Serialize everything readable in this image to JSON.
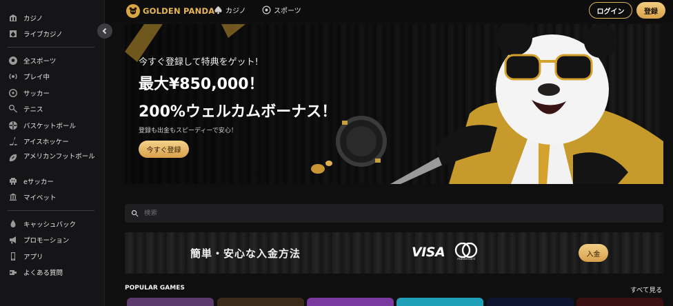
{
  "sidebar": {
    "group1": [
      {
        "label": "カジノ",
        "icon": "casino-icon"
      },
      {
        "label": "ライブカジノ",
        "icon": "live-casino-icon"
      }
    ],
    "group2": [
      {
        "label": "全スポーツ",
        "icon": "all-sports-icon"
      },
      {
        "label": "プレイ中",
        "icon": "live-play-icon"
      },
      {
        "label": "サッカー",
        "icon": "soccer-icon"
      },
      {
        "label": "テニス",
        "icon": "tennis-icon"
      },
      {
        "label": "バスケットボール",
        "icon": "basketball-icon"
      },
      {
        "label": "アイスホッケー",
        "icon": "ice-hockey-icon"
      },
      {
        "label": "アメリカンフットボール",
        "icon": "american-football-icon"
      },
      {
        "label": "eサッカー",
        "icon": "esoccer-icon"
      },
      {
        "label": "マイベット",
        "icon": "my-bets-icon"
      }
    ],
    "group3": [
      {
        "label": "キャッシュバック",
        "icon": "cashback-icon"
      },
      {
        "label": "プロモーション",
        "icon": "promotion-icon"
      },
      {
        "label": "アプリ",
        "icon": "app-icon"
      },
      {
        "label": "よくある質問",
        "icon": "faq-icon"
      }
    ]
  },
  "header": {
    "logo_text": "GOLDEN PANDA",
    "nav_casino": "カジノ",
    "nav_sports": "スポーツ",
    "login_label": "ログイン",
    "register_label": "登録"
  },
  "hero": {
    "subtitle": "今すぐ登録して特典をゲット!",
    "title1": "最大¥850,000！",
    "title2": "200%ウェルカムボーナス！",
    "note": "登録も出金もスピーディーで安心！",
    "cta": "今すぐ登録"
  },
  "search": {
    "placeholder": "検索"
  },
  "deposit": {
    "title": "簡単・安心な入金方法",
    "visa": "VISA",
    "mastercard": "mastercard",
    "cta": "入金"
  },
  "games": {
    "title": "POPULAR GAMES",
    "see_all": "すべて見る"
  },
  "colors": {
    "accent": "#e2b45a",
    "background": "#0f0f10",
    "sidebar": "#151517"
  }
}
